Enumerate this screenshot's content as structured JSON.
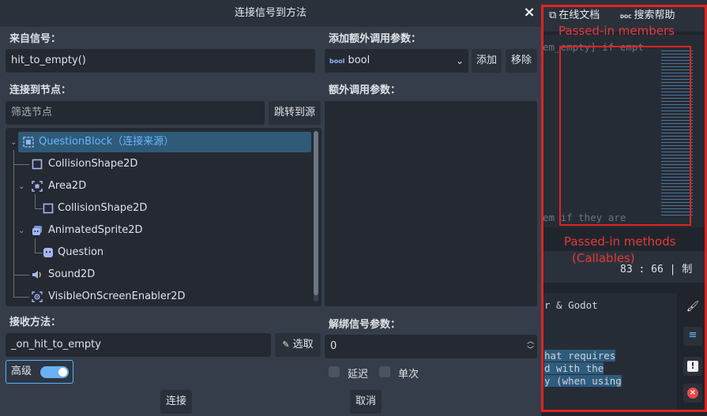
{
  "dialog": {
    "title": "连接信号到方法",
    "close_icon": "×",
    "from_signal_label": "来自信号：",
    "signal_value": "hit_to_empty()",
    "connect_to_node_label": "连接到节点：",
    "filter_placeholder": "筛选节点",
    "goto_source_button": "跳转到源",
    "tree": [
      {
        "name": "QuestionBlock（连接来源）",
        "icon": "tilemap-node-icon",
        "selected": true
      },
      {
        "name": "CollisionShape2D",
        "icon": "collision-shape-icon"
      },
      {
        "name": "Area2D",
        "icon": "area2d-icon"
      },
      {
        "name": "CollisionShape2D",
        "icon": "collision-shape-icon"
      },
      {
        "name": "AnimatedSprite2D",
        "icon": "animated-sprite-icon"
      },
      {
        "name": "Question",
        "icon": "sprite-face-icon"
      },
      {
        "name": "Sound2D",
        "icon": "speaker-icon"
      },
      {
        "name": "VisibleOnScreenEnabler2D",
        "icon": "visibility-notifier-icon"
      }
    ],
    "receiver_method_label": "接收方法：",
    "receiver_method_value": "_on_hit_to_empty",
    "pick_button": "选取",
    "pick_icon": "pencil-icon",
    "advanced_label": "高级",
    "advanced_on": true,
    "extra_args_add_label": "添加额外调用参数：",
    "type_select_value": "bool",
    "type_icon": "bool",
    "add_button": "添加",
    "remove_button": "移除",
    "extra_args_label": "额外调用参数：",
    "unbind_label": "解绑信号参数：",
    "unbind_value": "0",
    "deferred_label": "延迟",
    "oneshot_label": "单次",
    "connect_button": "连接",
    "cancel_button": "取消"
  },
  "side": {
    "online_docs": "在线文档",
    "search_help": "搜索帮助",
    "doc_icon_text": "DOC",
    "code_line_1": "em_empty] if empt",
    "code_line_2": "em if they are",
    "position_readout": "83 :  66 | 制",
    "code_lines": [
      "r & Godot",
      "hat requires",
      "d with the",
      "y (when using"
    ]
  },
  "annotations": {
    "members": "Passed-in members",
    "methods_line1": "Passed-in methods",
    "methods_line2": "(Callables)"
  },
  "colors": {
    "accent": "#4db5ff",
    "annotation_red": "#e02323",
    "selected_row": "#2f5a78"
  }
}
